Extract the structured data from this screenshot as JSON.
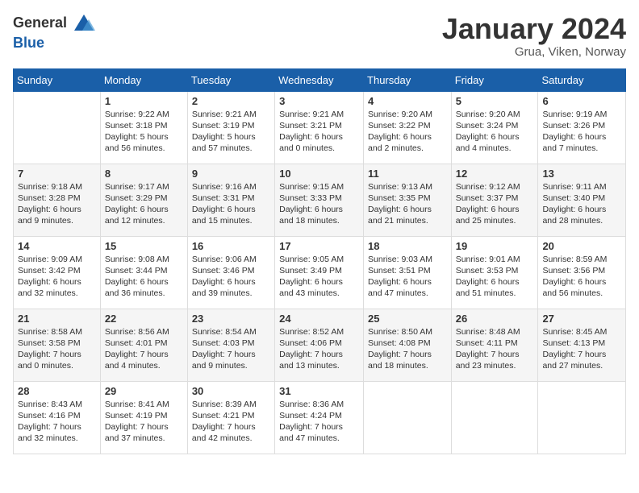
{
  "header": {
    "logo": {
      "general": "General",
      "blue": "Blue"
    },
    "title": "January 2024",
    "location": "Grua, Viken, Norway"
  },
  "calendar": {
    "days": [
      "Sunday",
      "Monday",
      "Tuesday",
      "Wednesday",
      "Thursday",
      "Friday",
      "Saturday"
    ],
    "rows": [
      [
        null,
        {
          "day": "1",
          "sunrise": "9:22 AM",
          "sunset": "3:18 PM",
          "daylight": "5 hours and 56 minutes."
        },
        {
          "day": "2",
          "sunrise": "9:21 AM",
          "sunset": "3:19 PM",
          "daylight": "5 hours and 57 minutes."
        },
        {
          "day": "3",
          "sunrise": "9:21 AM",
          "sunset": "3:21 PM",
          "daylight": "6 hours and 0 minutes."
        },
        {
          "day": "4",
          "sunrise": "9:20 AM",
          "sunset": "3:22 PM",
          "daylight": "6 hours and 2 minutes."
        },
        {
          "day": "5",
          "sunrise": "9:20 AM",
          "sunset": "3:24 PM",
          "daylight": "6 hours and 4 minutes."
        },
        {
          "day": "6",
          "sunrise": "9:19 AM",
          "sunset": "3:26 PM",
          "daylight": "6 hours and 7 minutes."
        }
      ],
      [
        {
          "day": "7",
          "sunrise": "9:18 AM",
          "sunset": "3:28 PM",
          "daylight": "6 hours and 9 minutes."
        },
        {
          "day": "8",
          "sunrise": "9:17 AM",
          "sunset": "3:29 PM",
          "daylight": "6 hours and 12 minutes."
        },
        {
          "day": "9",
          "sunrise": "9:16 AM",
          "sunset": "3:31 PM",
          "daylight": "6 hours and 15 minutes."
        },
        {
          "day": "10",
          "sunrise": "9:15 AM",
          "sunset": "3:33 PM",
          "daylight": "6 hours and 18 minutes."
        },
        {
          "day": "11",
          "sunrise": "9:13 AM",
          "sunset": "3:35 PM",
          "daylight": "6 hours and 21 minutes."
        },
        {
          "day": "12",
          "sunrise": "9:12 AM",
          "sunset": "3:37 PM",
          "daylight": "6 hours and 25 minutes."
        },
        {
          "day": "13",
          "sunrise": "9:11 AM",
          "sunset": "3:40 PM",
          "daylight": "6 hours and 28 minutes."
        }
      ],
      [
        {
          "day": "14",
          "sunrise": "9:09 AM",
          "sunset": "3:42 PM",
          "daylight": "6 hours and 32 minutes."
        },
        {
          "day": "15",
          "sunrise": "9:08 AM",
          "sunset": "3:44 PM",
          "daylight": "6 hours and 36 minutes."
        },
        {
          "day": "16",
          "sunrise": "9:06 AM",
          "sunset": "3:46 PM",
          "daylight": "6 hours and 39 minutes."
        },
        {
          "day": "17",
          "sunrise": "9:05 AM",
          "sunset": "3:49 PM",
          "daylight": "6 hours and 43 minutes."
        },
        {
          "day": "18",
          "sunrise": "9:03 AM",
          "sunset": "3:51 PM",
          "daylight": "6 hours and 47 minutes."
        },
        {
          "day": "19",
          "sunrise": "9:01 AM",
          "sunset": "3:53 PM",
          "daylight": "6 hours and 51 minutes."
        },
        {
          "day": "20",
          "sunrise": "8:59 AM",
          "sunset": "3:56 PM",
          "daylight": "6 hours and 56 minutes."
        }
      ],
      [
        {
          "day": "21",
          "sunrise": "8:58 AM",
          "sunset": "3:58 PM",
          "daylight": "7 hours and 0 minutes."
        },
        {
          "day": "22",
          "sunrise": "8:56 AM",
          "sunset": "4:01 PM",
          "daylight": "7 hours and 4 minutes."
        },
        {
          "day": "23",
          "sunrise": "8:54 AM",
          "sunset": "4:03 PM",
          "daylight": "7 hours and 9 minutes."
        },
        {
          "day": "24",
          "sunrise": "8:52 AM",
          "sunset": "4:06 PM",
          "daylight": "7 hours and 13 minutes."
        },
        {
          "day": "25",
          "sunrise": "8:50 AM",
          "sunset": "4:08 PM",
          "daylight": "7 hours and 18 minutes."
        },
        {
          "day": "26",
          "sunrise": "8:48 AM",
          "sunset": "4:11 PM",
          "daylight": "7 hours and 23 minutes."
        },
        {
          "day": "27",
          "sunrise": "8:45 AM",
          "sunset": "4:13 PM",
          "daylight": "7 hours and 27 minutes."
        }
      ],
      [
        {
          "day": "28",
          "sunrise": "8:43 AM",
          "sunset": "4:16 PM",
          "daylight": "7 hours and 32 minutes."
        },
        {
          "day": "29",
          "sunrise": "8:41 AM",
          "sunset": "4:19 PM",
          "daylight": "7 hours and 37 minutes."
        },
        {
          "day": "30",
          "sunrise": "8:39 AM",
          "sunset": "4:21 PM",
          "daylight": "7 hours and 42 minutes."
        },
        {
          "day": "31",
          "sunrise": "8:36 AM",
          "sunset": "4:24 PM",
          "daylight": "7 hours and 47 minutes."
        },
        null,
        null,
        null
      ]
    ]
  }
}
